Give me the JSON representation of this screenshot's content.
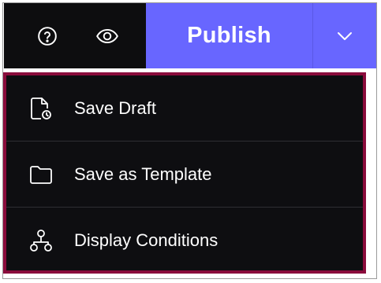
{
  "toolbar": {
    "help_icon": "question-circle-icon",
    "preview_icon": "eye-icon",
    "publish_label": "Publish",
    "toggle_icon": "chevron-down-icon"
  },
  "menu": {
    "items": [
      {
        "label": "Save Draft",
        "icon": "file-clock-icon"
      },
      {
        "label": "Save as Template",
        "icon": "folder-icon"
      },
      {
        "label": "Display Conditions",
        "icon": "sitemap-icon"
      }
    ]
  },
  "colors": {
    "toolbar_bg": "#0d0d0f",
    "accent": "#6866ff",
    "menu_bg": "#0e0e11",
    "menu_border": "#8a0c3c"
  }
}
